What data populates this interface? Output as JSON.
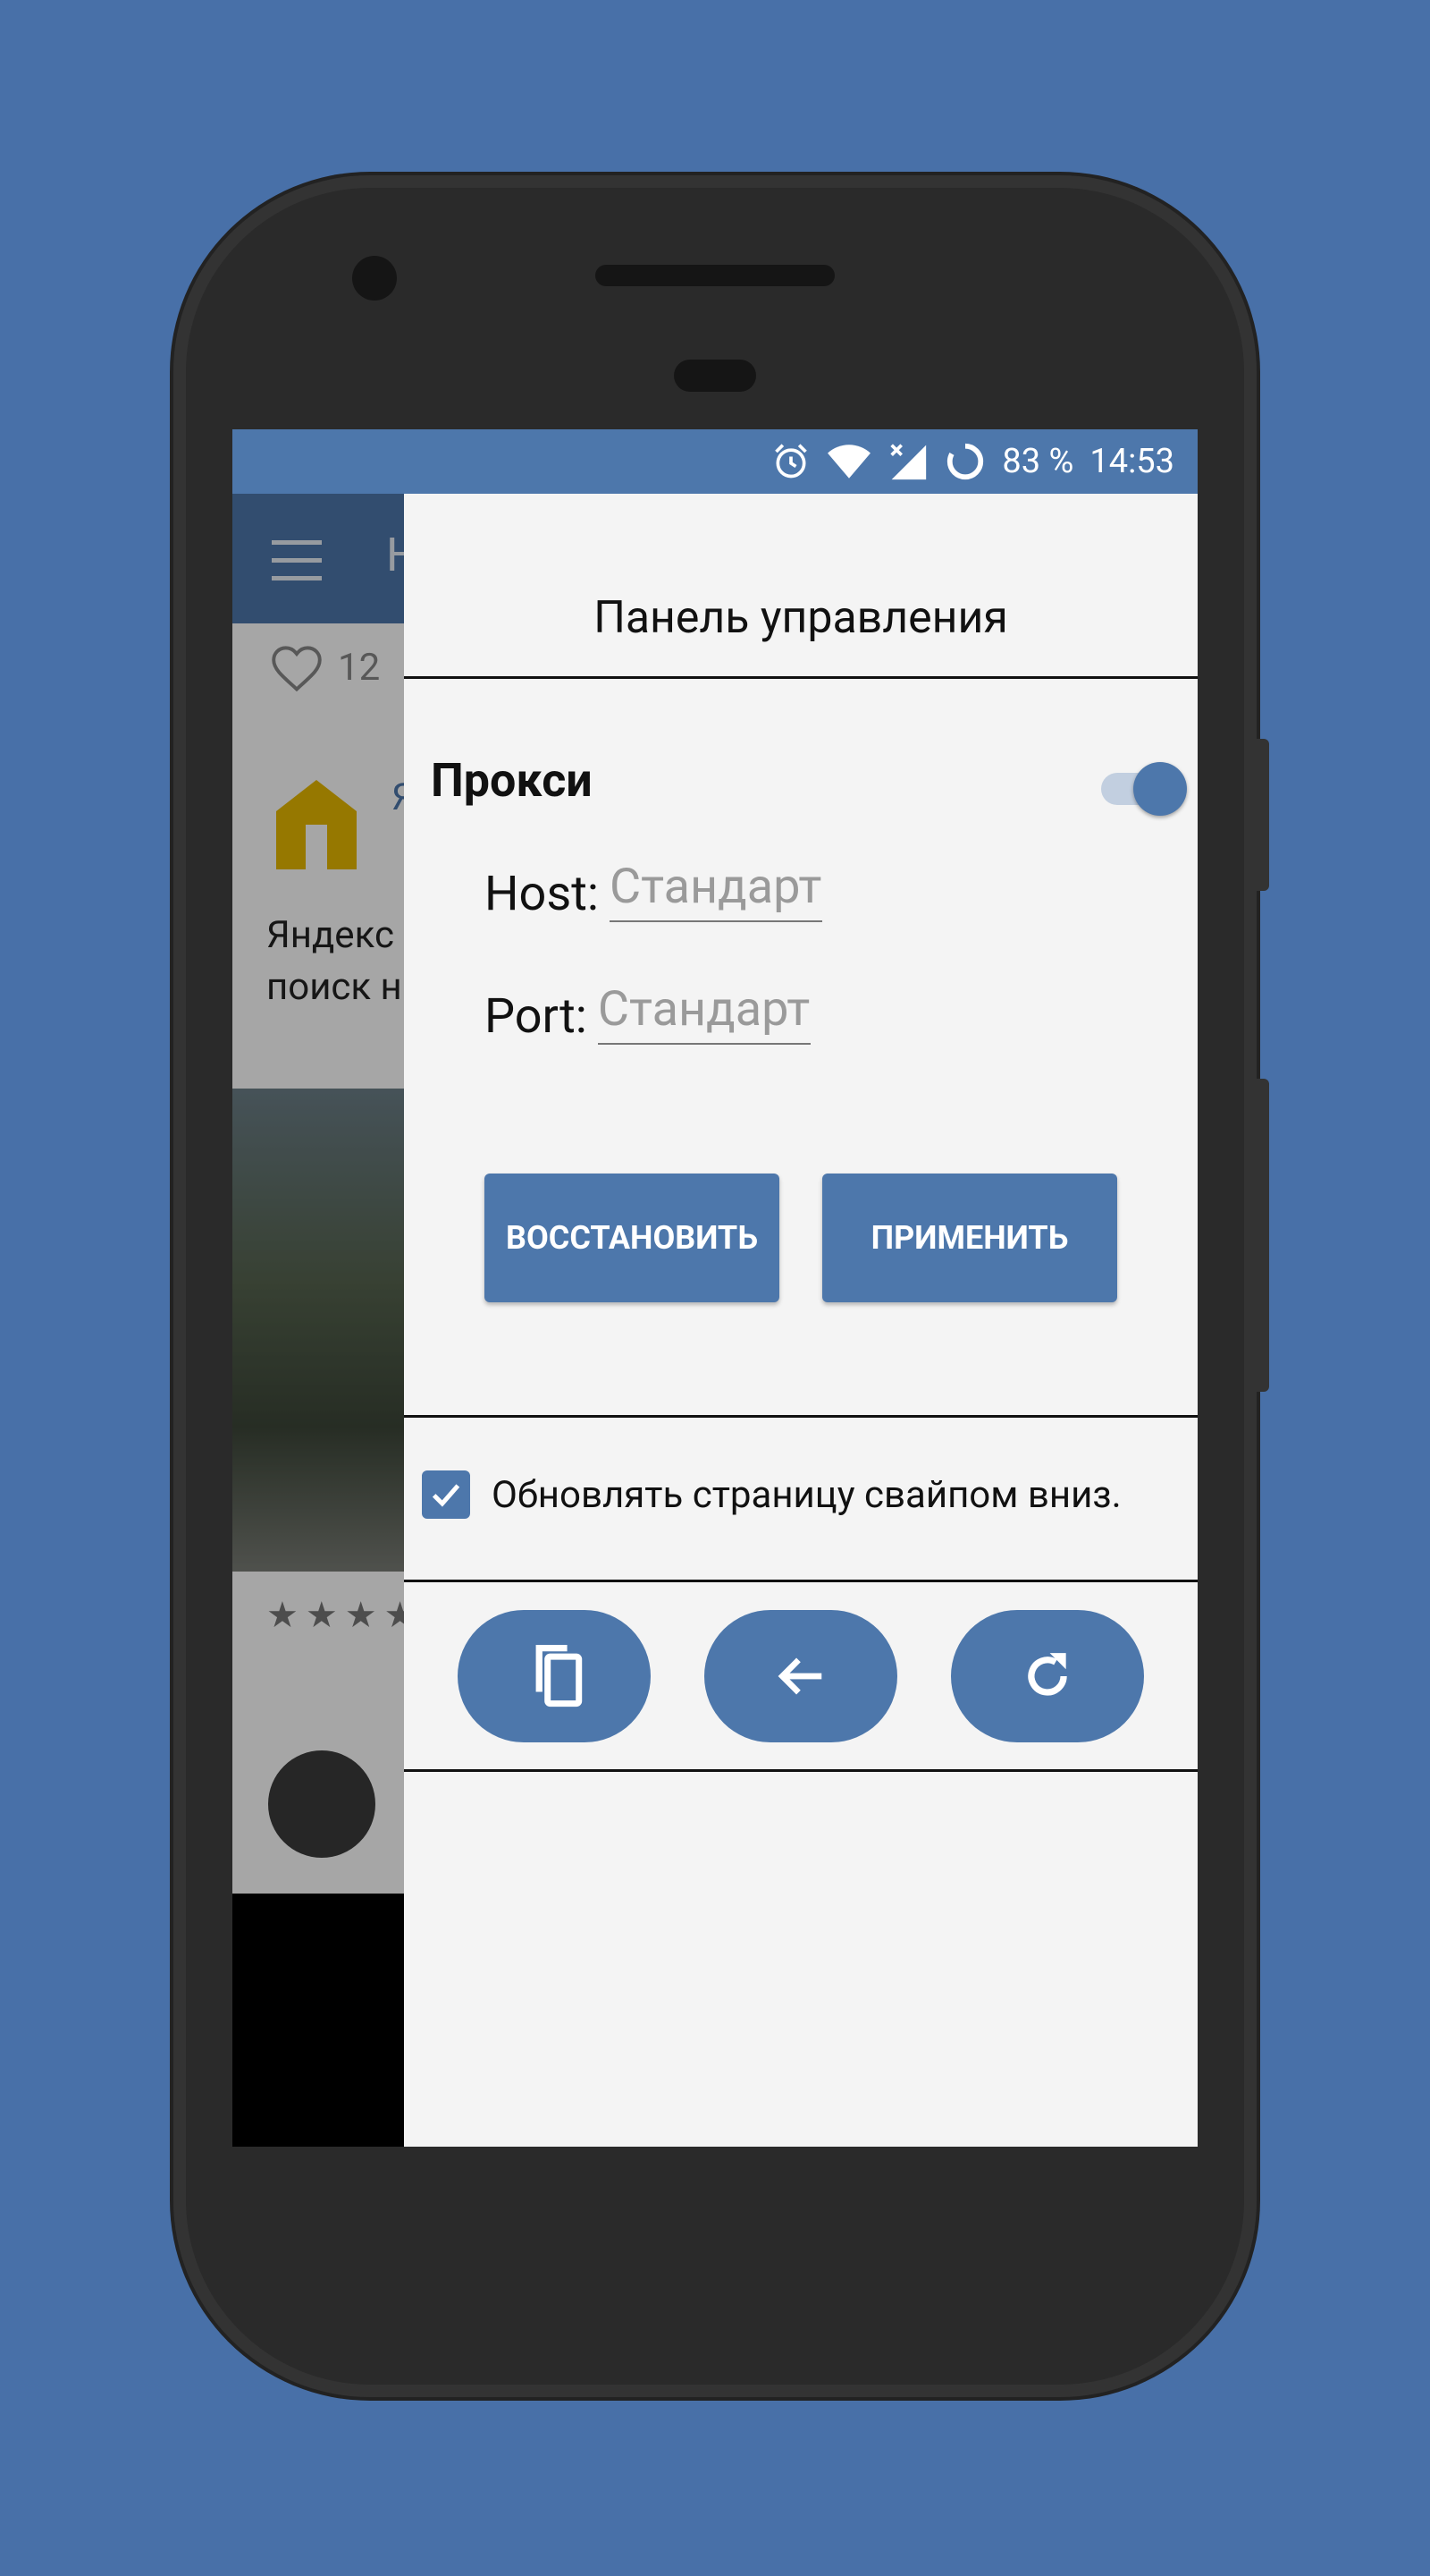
{
  "status_bar": {
    "battery": "83 %",
    "time": "14:53"
  },
  "background_app": {
    "title_partial": "Н",
    "likes_count": "12",
    "post_text_line1": "Яндекс",
    "post_text_line2": "поиск н",
    "author_partial": "Я",
    "rating_stars": "★★★★"
  },
  "panel": {
    "title": "Панель управления",
    "proxy": {
      "label": "Прокси",
      "enabled": true,
      "host_label": "Host:",
      "host_value": "",
      "host_placeholder": "Стандарт",
      "port_label": "Port:",
      "port_value": "",
      "port_placeholder": "Стандарт",
      "restore_button": "ВОССТАНОВИТЬ",
      "apply_button": "ПРИМЕНИТЬ"
    },
    "swipe_refresh": {
      "label": "Обновлять страницу свайпом вниз.",
      "checked": true
    },
    "actions": [
      "copy-icon",
      "arrow-back-icon",
      "refresh-icon"
    ]
  },
  "colors": {
    "accent": "#4d77ab",
    "page_background": "#4870a8",
    "panel_background": "#f4f4f4"
  }
}
